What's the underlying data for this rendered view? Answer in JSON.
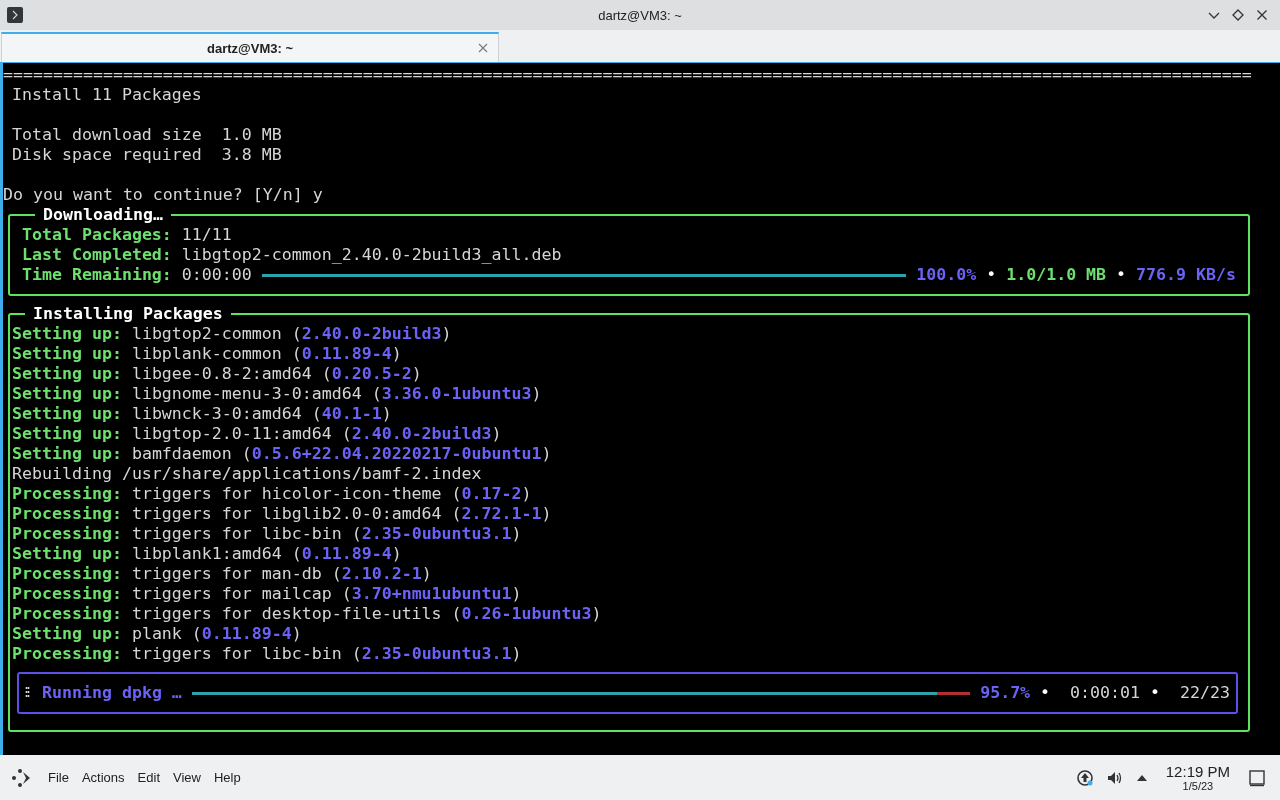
{
  "window": {
    "title": "dartz@VM3: ~"
  },
  "tabs": [
    {
      "label": "dartz@VM3: ~",
      "selected": true
    }
  ],
  "summary": [
    [
      {
        "text": "=============================================================================================================================",
        "indented": false
      },
      {
        "text": "Install 11 Packages",
        "indented": true
      }
    ],
    [
      {
        "text": "Total download size  1.0 MB",
        "indented": true
      },
      {
        "text": "Disk space required  3.8 MB",
        "indented": true
      }
    ],
    [
      {
        "text": "Do you want to continue? [Y/n] y",
        "indented": false
      }
    ]
  ],
  "download_panel": {
    "title": "Downloading…",
    "rows": [
      {
        "label": "Total Packages:",
        "value": "11/11"
      },
      {
        "label": "Last Completed:",
        "value": "libgtop2-common_2.40.0-2build3_all.deb"
      },
      {
        "label": "Time Remaining:",
        "value": "0:00:00"
      }
    ],
    "level": 1.0,
    "percent": "100.0%",
    "size": "1.0/1.0 MB",
    "speed": "776.9 KB/s",
    "separators": [
      "•",
      "•"
    ]
  },
  "install_panel": {
    "title": "Installing Packages",
    "lines": [
      [
        {
          "text": "Setting up:",
          "kind": "label"
        },
        {
          "text": " libgtop2-common ("
        },
        {
          "text": "2.40.0-2build3",
          "kind": "version"
        },
        {
          "text": ")"
        }
      ],
      [
        {
          "text": "Setting up:",
          "kind": "label"
        },
        {
          "text": " libplank-common ("
        },
        {
          "text": "0.11.89-4",
          "kind": "version"
        },
        {
          "text": ")"
        }
      ],
      [
        {
          "text": "Setting up:",
          "kind": "label"
        },
        {
          "text": " libgee-0.8-2:amd64 ("
        },
        {
          "text": "0.20.5-2",
          "kind": "version"
        },
        {
          "text": ")"
        }
      ],
      [
        {
          "text": "Setting up:",
          "kind": "label"
        },
        {
          "text": " libgnome-menu-3-0:amd64 ("
        },
        {
          "text": "3.36.0-1ubuntu3",
          "kind": "version"
        },
        {
          "text": ")"
        }
      ],
      [
        {
          "text": "Setting up:",
          "kind": "label"
        },
        {
          "text": " libwnck-3-0:amd64 ("
        },
        {
          "text": "40.1-1",
          "kind": "version"
        },
        {
          "text": ")"
        }
      ],
      [
        {
          "text": "Setting up:",
          "kind": "label"
        },
        {
          "text": " libgtop-2.0-11:amd64 ("
        },
        {
          "text": "2.40.0-2build3",
          "kind": "version"
        },
        {
          "text": ")"
        }
      ],
      [
        {
          "text": "Setting up:",
          "kind": "label"
        },
        {
          "text": " bamfdaemon ("
        },
        {
          "text": "0.5.6+22.04.20220217-0ubuntu1",
          "kind": "version"
        },
        {
          "text": ")"
        }
      ],
      [
        {
          "text": "Rebuilding /usr/share/applications/bamf-2.index"
        }
      ],
      [
        {
          "text": "Processing:",
          "kind": "label"
        },
        {
          "text": " triggers for hicolor-icon-theme ("
        },
        {
          "text": "0.17-2",
          "kind": "version"
        },
        {
          "text": ")"
        }
      ],
      [
        {
          "text": "Processing:",
          "kind": "label"
        },
        {
          "text": " triggers for libglib2.0-0:amd64 ("
        },
        {
          "text": "2.72.1-1",
          "kind": "version"
        },
        {
          "text": ")"
        }
      ],
      [
        {
          "text": "Processing:",
          "kind": "label"
        },
        {
          "text": " triggers for libc-bin ("
        },
        {
          "text": "2.35-0ubuntu3.1",
          "kind": "version"
        },
        {
          "text": ")"
        }
      ],
      [
        {
          "text": "Setting up:",
          "kind": "label"
        },
        {
          "text": " libplank1:amd64 ("
        },
        {
          "text": "0.11.89-4",
          "kind": "version"
        },
        {
          "text": ")"
        }
      ],
      [
        {
          "text": "Processing:",
          "kind": "label"
        },
        {
          "text": " triggers for man-db ("
        },
        {
          "text": "2.10.2-1",
          "kind": "version"
        },
        {
          "text": ")"
        }
      ],
      [
        {
          "text": "Processing:",
          "kind": "label"
        },
        {
          "text": " triggers for mailcap ("
        },
        {
          "text": "3.70+nmu1ubuntu1",
          "kind": "version"
        },
        {
          "text": ")"
        }
      ],
      [
        {
          "text": "Processing:",
          "kind": "label"
        },
        {
          "text": " triggers for desktop-file-utils ("
        },
        {
          "text": "0.26-1ubuntu3",
          "kind": "version"
        },
        {
          "text": ")"
        }
      ],
      [
        {
          "text": "Setting up:",
          "kind": "label"
        },
        {
          "text": " plank ("
        },
        {
          "text": "0.11.89-4",
          "kind": "version"
        },
        {
          "text": ")"
        }
      ],
      [
        {
          "text": "Processing:",
          "kind": "label"
        },
        {
          "text": " triggers for libc-bin ("
        },
        {
          "text": "2.35-0ubuntu3.1",
          "kind": "version"
        },
        {
          "text": ")"
        }
      ]
    ],
    "task": {
      "label": "Running dpkg …",
      "level": 0.957,
      "percent": "95.7%",
      "elapsed": "0:00:01",
      "count": "22/23",
      "separators": [
        "•",
        "•"
      ]
    }
  },
  "menu": [
    "File",
    "Actions",
    "Edit",
    "View",
    "Help"
  ],
  "clock": {
    "time": "12:19 PM",
    "date": "1/5/23"
  }
}
